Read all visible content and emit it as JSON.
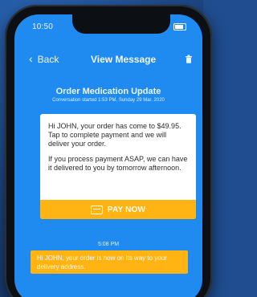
{
  "status_bar": {
    "time": "10:50",
    "signal_icon": "signal-bars-icon",
    "wifi_icon": "wifi-icon",
    "battery_icon": "battery-icon"
  },
  "nav": {
    "back_label": "Back",
    "title": "View Message",
    "back_icon": "chevron-left-icon",
    "trash_icon": "trash-icon"
  },
  "conversation": {
    "title": "Order Medication Update",
    "started": "Conversation started 1:53 PM, Sunday 29 Mar. 2020"
  },
  "message_card": {
    "paragraph1": "Hi JOHN, your order has come to $49.95. Tap to complete payment and we will deliver your order.",
    "paragraph2": "If you process payment ASAP, we can have it delivered to you by tomorrow afternoon.",
    "button_label": "PAY NOW",
    "button_icon": "credit-card-icon"
  },
  "timeline": {
    "time": "5:08 PM"
  },
  "reply_bubble": {
    "text": "Hi JOHN, your order is now on its way to your delivery address."
  },
  "colors": {
    "screen_bg": "#1f8bf0",
    "accent_yellow": "#ffb414",
    "frame": "#0c0f14",
    "page_bg": "#1f4d8f"
  }
}
